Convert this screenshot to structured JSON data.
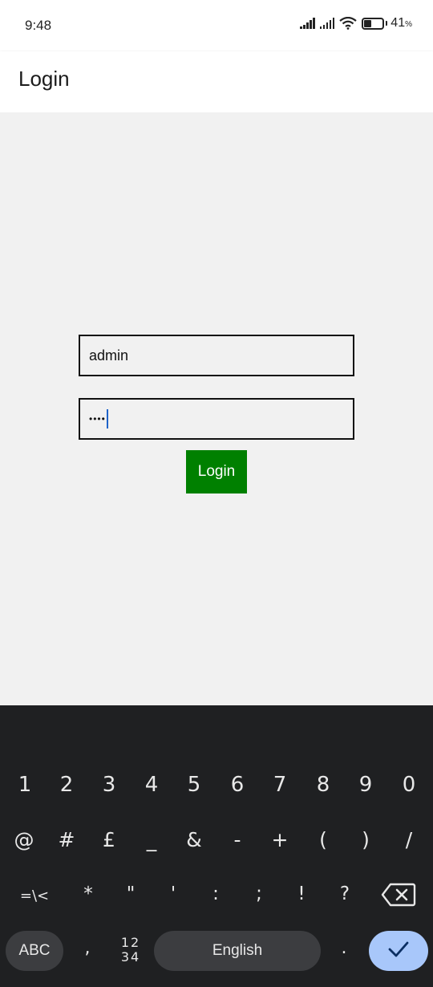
{
  "status_bar": {
    "time": "9:48",
    "battery_percent": "41",
    "battery_percent_sign": "%",
    "battery_level": 0.41,
    "icons": [
      "signal-icon",
      "signal-icon",
      "wifi-icon",
      "battery-icon"
    ]
  },
  "app_bar": {
    "title": "Login"
  },
  "form": {
    "username_value": "admin",
    "password_masked": "••••",
    "login_label": "Login",
    "login_color": "#008000"
  },
  "keyboard": {
    "row1": [
      "1",
      "2",
      "3",
      "4",
      "5",
      "6",
      "7",
      "8",
      "9",
      "0"
    ],
    "row2": [
      "@",
      "#",
      "£",
      "_",
      "&",
      "-",
      "+",
      "(",
      ")",
      "/"
    ],
    "row3": [
      "=\\<",
      "*",
      "\"",
      "'",
      ":",
      ";",
      "!",
      "?"
    ],
    "backspace_icon": "backspace-icon",
    "abc_label": "ABC",
    "comma_label": ",",
    "numpad_line1": "12",
    "numpad_line2": "34",
    "space_label": "English",
    "period_label": ".",
    "enter_icon": "check-icon",
    "enter_color": "#a8c7fa"
  }
}
